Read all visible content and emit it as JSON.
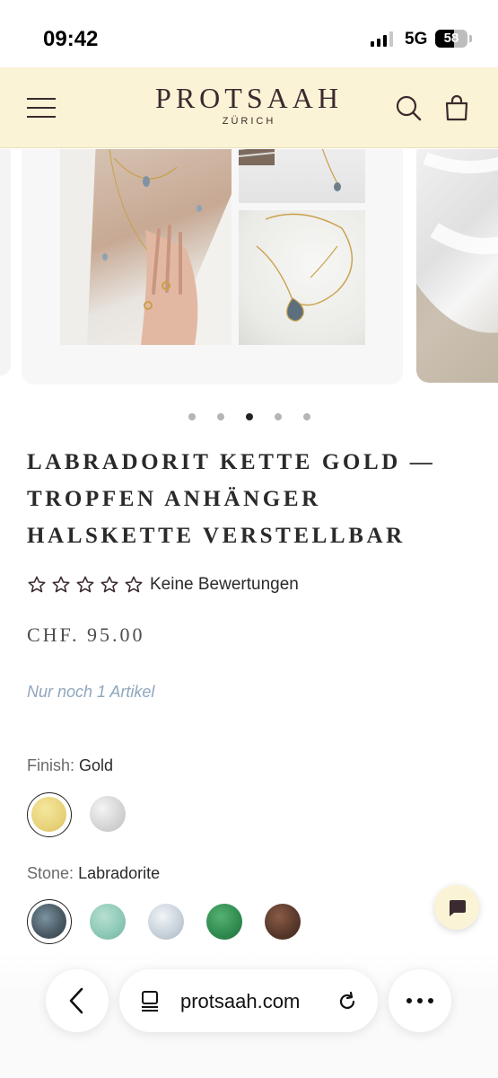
{
  "status_bar": {
    "time": "09:42",
    "network": "5G",
    "battery_percent": "58",
    "signal_bars_active": 3
  },
  "header": {
    "brand_name": "PROTSAAH",
    "brand_location": "ZÜRICH",
    "menu_icon": "hamburger-menu-icon",
    "search_icon": "search-icon",
    "cart_icon": "shopping-bag-icon",
    "background_color": "#fbf3d5"
  },
  "gallery": {
    "slide_count": 5,
    "active_slide": 3
  },
  "product": {
    "title": "LABRADORIT KETTE GOLD — TROPFEN ANHÄNGER HALSKETTE VERSTELLBAR",
    "rating_stars": 0,
    "rating_max": 5,
    "rating_text": "Keine Bewertungen",
    "price": "CHF. 95.00",
    "stock_text": "Nur noch 1 Artikel"
  },
  "options": {
    "finish": {
      "label": "Finish:",
      "selected": "Gold",
      "swatches": [
        {
          "name": "Gold",
          "color": "#e8d27a",
          "selected": true
        },
        {
          "name": "Silver",
          "color": "#d6d6d6",
          "selected": false
        }
      ]
    },
    "stone": {
      "label": "Stone:",
      "selected": "Labradorite",
      "swatches": [
        {
          "name": "Labradorite",
          "color": "#4c5c66",
          "selected": true
        },
        {
          "name": "Aquamarine",
          "color": "#8cc7b5",
          "selected": false
        },
        {
          "name": "Moonstone",
          "color": "#c9d3dc",
          "selected": false
        },
        {
          "name": "Green",
          "color": "#2f8a4f",
          "selected": false
        },
        {
          "name": "Brown",
          "color": "#5a3a2c",
          "selected": false
        }
      ]
    }
  },
  "chat": {
    "icon": "chat-bubble-icon"
  },
  "browser": {
    "url": "protsaah.com",
    "back_icon": "chevron-left-icon",
    "tabs_icon": "page-settings-icon",
    "reload_icon": "reload-icon",
    "more_icon": "more-dots-icon"
  }
}
